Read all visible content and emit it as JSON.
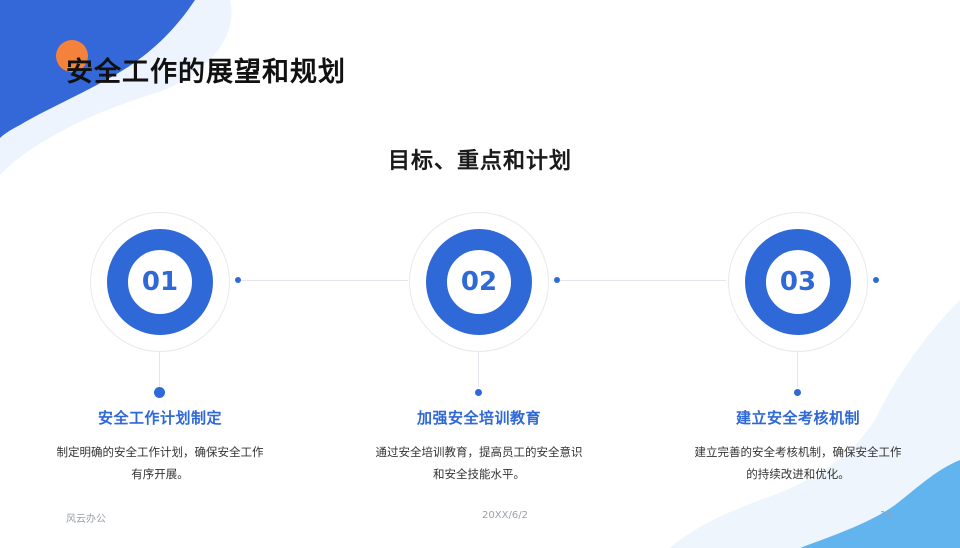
{
  "title": "安全工作的展望和规划",
  "subtitle": "目标、重点和计划",
  "steps": [
    {
      "number": "01",
      "title": "安全工作计划制定",
      "desc_line1": "制定明确的安全工作计划，确保安全工作",
      "desc_line2": "有序开展。"
    },
    {
      "number": "02",
      "title": "加强安全培训教育",
      "desc_line1": "通过安全培训教育，提高员工的安全意识",
      "desc_line2": "和安全技能水平。"
    },
    {
      "number": "03",
      "title": "建立安全考核机制",
      "desc_line1": "建立完善的安全考核机制，确保安全工作",
      "desc_line2": "的持续改进和优化。"
    }
  ],
  "footer": {
    "company": "风云办公",
    "date": "20XX/6/2",
    "page": "18"
  },
  "colors": {
    "accent_blue": "#2f68d7",
    "accent_orange": "#f5823a",
    "light_blue": "#5fb3ee"
  }
}
